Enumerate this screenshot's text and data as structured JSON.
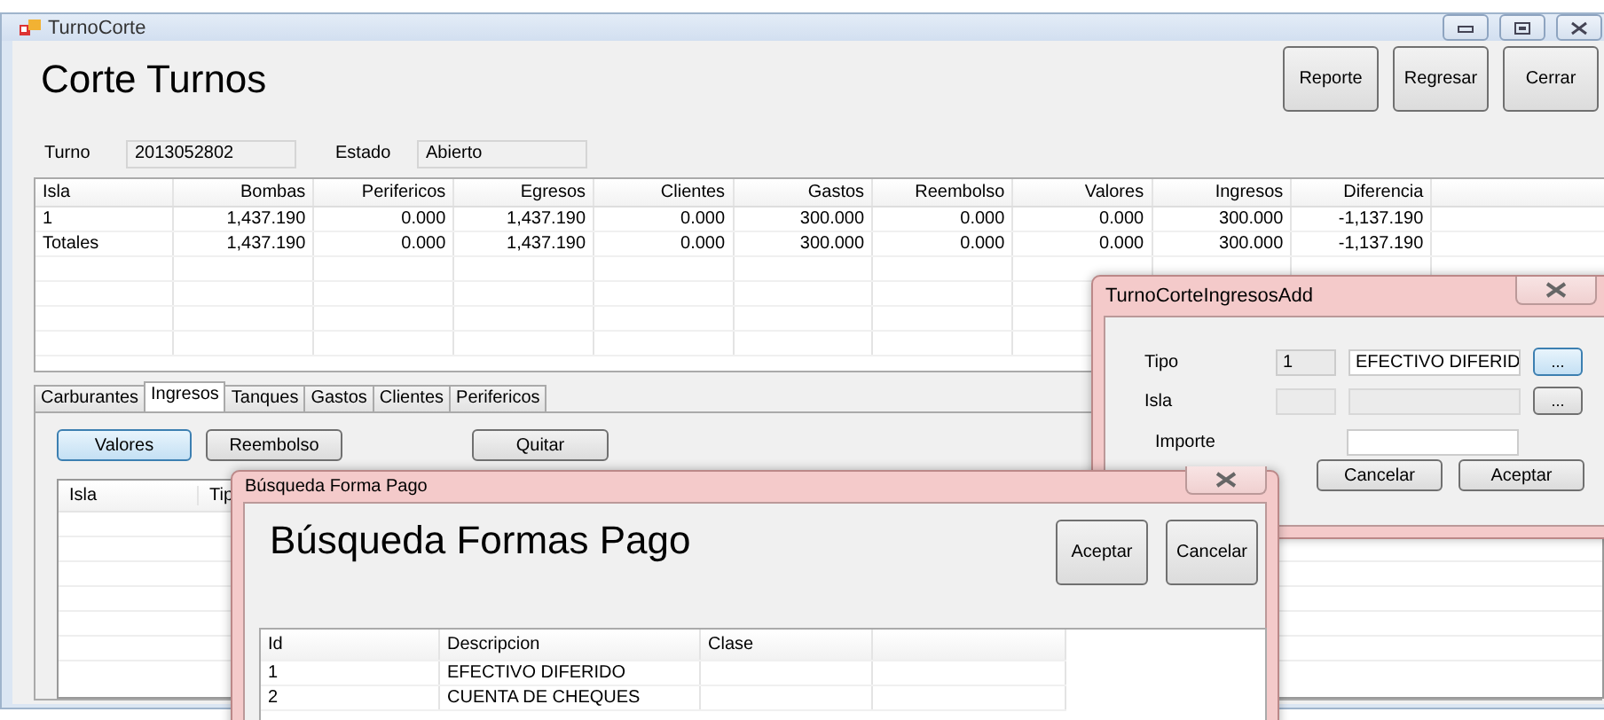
{
  "window": {
    "title": "TurnoCorte",
    "heading": "Corte Turnos",
    "buttons": [
      "Reporte",
      "Regresar",
      "Cerrar"
    ]
  },
  "fields": [
    {
      "label": "Turno",
      "value": "2013052802"
    },
    {
      "label": "Estado",
      "value": "Abierto"
    }
  ],
  "summary_table": {
    "columns": [
      "Isla",
      "Bombas",
      "Perifericos",
      "Egresos",
      "Clientes",
      "Gastos",
      "Reembolso",
      "Valores",
      "Ingresos",
      "Diferencia"
    ],
    "rows": [
      [
        "1",
        "1,437.190",
        "0.000",
        "1,437.190",
        "0.000",
        "300.000",
        "0.000",
        "0.000",
        "300.000",
        "-1,137.190"
      ],
      [
        "Totales",
        "1,437.190",
        "0.000",
        "1,437.190",
        "0.000",
        "300.000",
        "0.000",
        "0.000",
        "300.000",
        "-1,137.190"
      ]
    ]
  },
  "tabs": [
    {
      "label": "Carburantes",
      "selected": false
    },
    {
      "label": "Ingresos",
      "selected": true
    },
    {
      "label": "Tanques",
      "selected": false
    },
    {
      "label": "Gastos",
      "selected": false
    },
    {
      "label": "Clientes",
      "selected": false
    },
    {
      "label": "Perifericos",
      "selected": false
    }
  ],
  "tab_buttons": [
    {
      "label": "Valores",
      "focused": true
    },
    {
      "label": "Reembolso",
      "focused": false
    },
    {
      "label": "Quitar",
      "focused": false
    }
  ],
  "ingresos_table": {
    "columns": [
      "Isla",
      "Tip"
    ]
  },
  "add_dialog": {
    "title": "TurnoCorteIngresosAdd",
    "rows": [
      {
        "kind": "lookup",
        "label": "Tipo",
        "code": "1",
        "description": "EFECTIVO DIFERID",
        "button": "...",
        "disabled": false,
        "button_focused": true
      },
      {
        "kind": "lookup",
        "label": "Isla",
        "code": "",
        "description": "",
        "button": "...",
        "disabled": true,
        "button_focused": false
      },
      {
        "kind": "amount",
        "label": "Importe",
        "value": ""
      }
    ],
    "buttons": [
      "Cancelar",
      "Aceptar"
    ]
  },
  "search_dialog": {
    "title": "Búsqueda Forma Pago",
    "heading": "Búsqueda Formas Pago",
    "buttons": [
      "Aceptar",
      "Cancelar"
    ],
    "table": {
      "columns": [
        "Id",
        "Descripcion",
        "Clase"
      ],
      "rows": [
        [
          "1",
          "EFECTIVO DIFERIDO",
          ""
        ],
        [
          "2",
          "CUENTA DE CHEQUES",
          ""
        ]
      ]
    }
  }
}
